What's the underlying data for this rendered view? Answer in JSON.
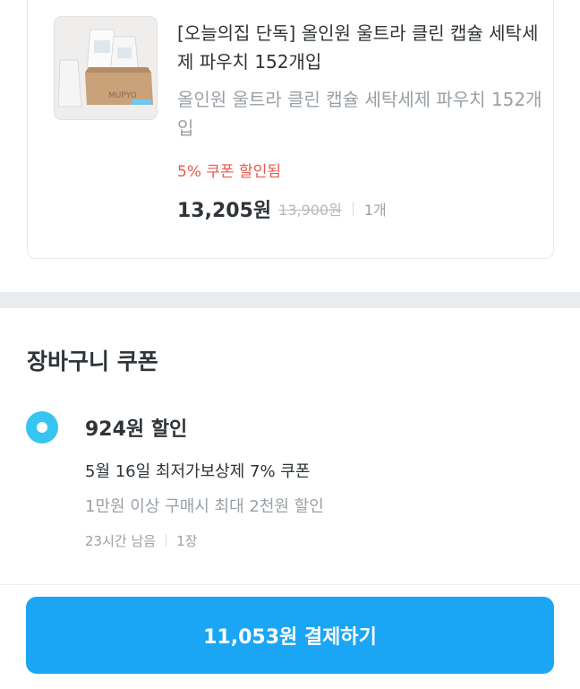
{
  "product": {
    "title": "[오늘의집 단독] 올인원 울트라 클린 캡슐 세탁세제 파우치 152개입",
    "option": "올인원 울트라 클린 캡슐 세탁세제 파우치 152개입",
    "coupon_applied": "5% 쿠폰 할인됨",
    "price_final": "13,205원",
    "price_original": "13,900원",
    "quantity": "1개",
    "image_brand_text": "MUPYO"
  },
  "cart_coupon": {
    "heading": "장바구니 쿠폰",
    "selected": true,
    "amount": "924원 할인",
    "name": "5월 16일 최저가보상제 7% 쿠폰",
    "condition": "1만원 이상 구매시 최대 2천원 할인",
    "time_left": "23시간 남음",
    "count": "1장"
  },
  "checkout": {
    "pay_label": "11,053원 결제하기"
  },
  "colors": {
    "accent": "#35c5f0",
    "pay_button": "#1aa6f5",
    "discount_red": "#e85a4f"
  }
}
